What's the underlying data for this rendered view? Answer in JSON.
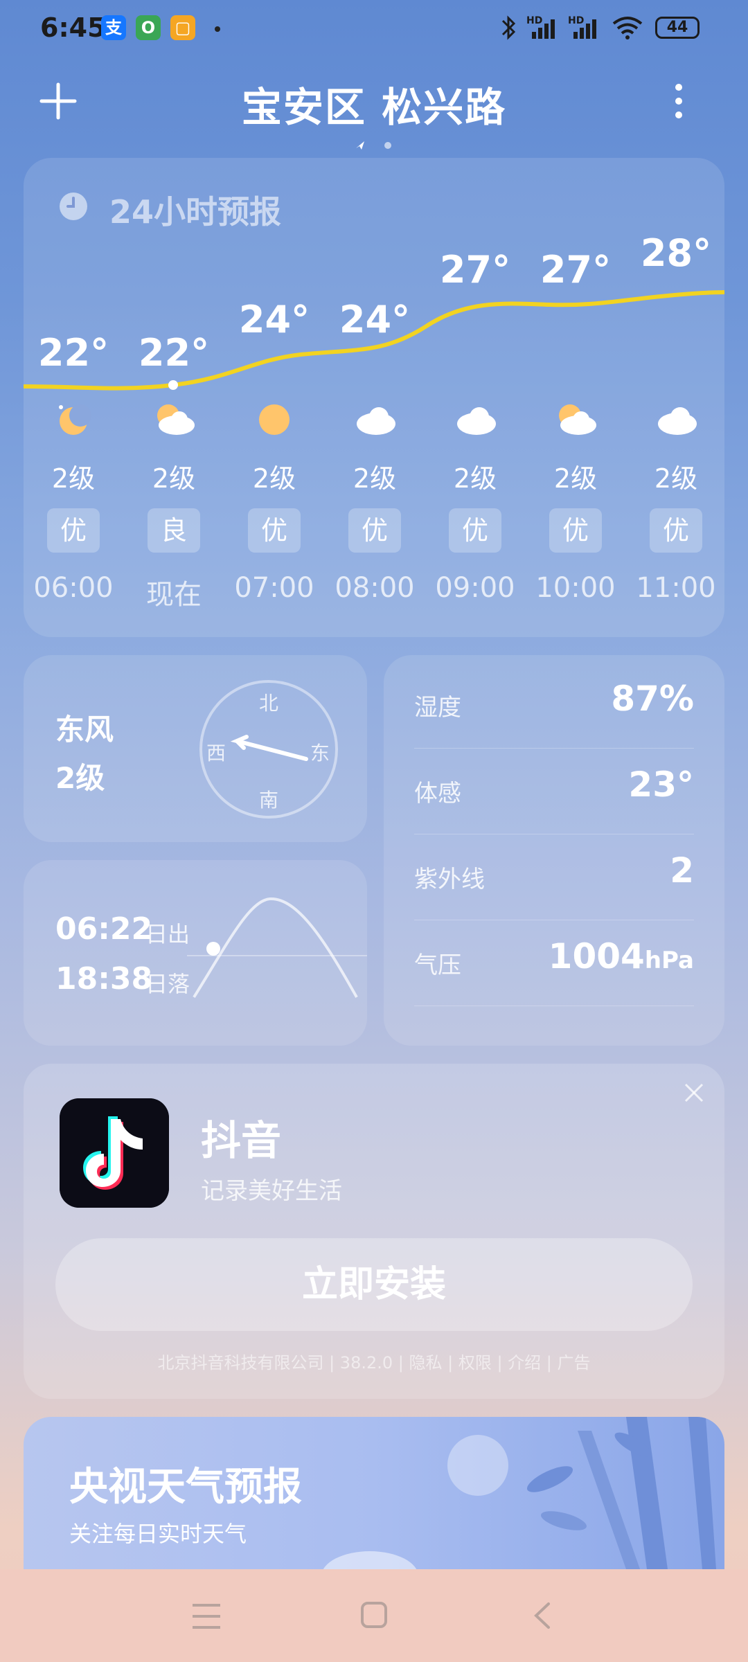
{
  "status_bar": {
    "time": "6:45",
    "app_icons": [
      "支",
      "O",
      "▢"
    ],
    "signal_labels": [
      "HD",
      "HD"
    ],
    "battery": "44"
  },
  "header": {
    "title": "宝安区 松兴路"
  },
  "forecast": {
    "title": "24小时预报",
    "hours": [
      {
        "temp": "22°",
        "icon": "moon-partly-cloudy-icon",
        "wind": "2级",
        "aqi": "优",
        "time": "06:00"
      },
      {
        "temp": "22°",
        "icon": "partly-cloudy-icon",
        "wind": "2级",
        "aqi": "良",
        "time": "现在"
      },
      {
        "temp": "24°",
        "icon": "sun-icon",
        "wind": "2级",
        "aqi": "优",
        "time": "07:00"
      },
      {
        "temp": "24°",
        "icon": "cloud-icon",
        "wind": "2级",
        "aqi": "优",
        "time": "08:00"
      },
      {
        "temp": "27°",
        "icon": "cloud-icon",
        "wind": "2级",
        "aqi": "优",
        "time": "09:00"
      },
      {
        "temp": "27°",
        "icon": "partly-cloudy-icon",
        "wind": "2级",
        "aqi": "优",
        "time": "10:00"
      },
      {
        "temp": "28°",
        "icon": "cloud-icon",
        "wind": "2级",
        "aqi": "优",
        "time": "11:00"
      }
    ]
  },
  "wind": {
    "direction": "东风",
    "level": "2级",
    "compass": {
      "n": "北",
      "s": "南",
      "e": "东",
      "w": "西"
    }
  },
  "sun": {
    "sunrise_time": "06:22",
    "sunrise_label": "日出",
    "sunset_time": "18:38",
    "sunset_label": "日落"
  },
  "details": [
    {
      "label": "湿度",
      "value": "87%",
      "unit": ""
    },
    {
      "label": "体感",
      "value": "23°",
      "unit": ""
    },
    {
      "label": "紫外线",
      "value": "2",
      "unit": ""
    },
    {
      "label": "气压",
      "value": "1004",
      "unit": "hPa"
    }
  ],
  "ad": {
    "app_name": "抖音",
    "app_desc": "记录美好生活",
    "install_label": "立即安装",
    "footer": "北京抖音科技有限公司 | 38.2.0 | 隐私 | 权限 | 介绍 | 广告"
  },
  "cctv": {
    "title": "央视天气预报",
    "subtitle": "关注每日实时天气"
  },
  "colors": {
    "temp_curve": "#f2d321",
    "sun_icon": "#ffc56b"
  }
}
